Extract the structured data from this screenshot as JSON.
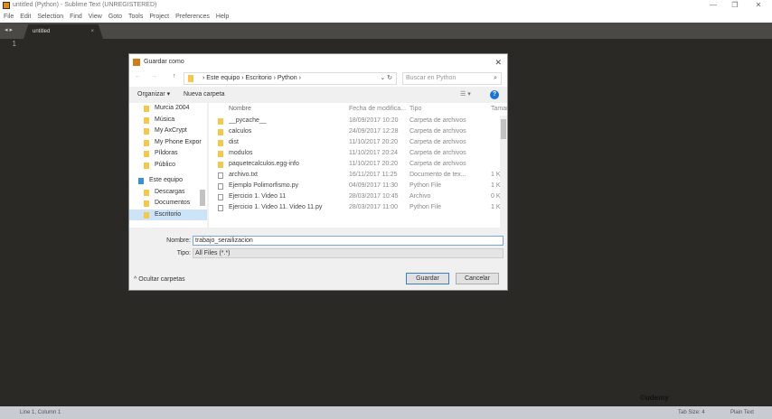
{
  "window": {
    "title": "untitled (Python) - Sublime Text (UNREGISTERED)",
    "min": "—",
    "max": "❐",
    "close": "✕"
  },
  "menu": [
    "File",
    "Edit",
    "Selection",
    "Find",
    "View",
    "Goto",
    "Tools",
    "Project",
    "Preferences",
    "Help"
  ],
  "tab": {
    "label": "untitled",
    "close": "×",
    "nav": "◂ ▸"
  },
  "editor": {
    "line": "1"
  },
  "status": {
    "left": "Line 1, Column 1",
    "tab_size": "Tab Size: 4",
    "syntax": "Plain Text"
  },
  "watermark": "©udemy",
  "dialog": {
    "title": "Guardar como",
    "close": "✕",
    "breadcrumb": "›  Este equipo  ›  Escritorio  ›  Python  ›",
    "search_placeholder": "Buscar en Python",
    "organize": "Organizar ▾",
    "new_folder": "Nueva carpeta",
    "help": "?",
    "view": "☰ ▾",
    "nav": [
      {
        "label": "Murcia 2004"
      },
      {
        "label": "Música"
      },
      {
        "label": "My AxCrypt"
      },
      {
        "label": "My Phone Expor"
      },
      {
        "label": "Píldoras"
      },
      {
        "label": "Público"
      },
      {
        "label": "Este equipo"
      },
      {
        "label": "Descargas"
      },
      {
        "label": "Documentos"
      },
      {
        "label": "Escritorio",
        "selected": true
      }
    ],
    "columns": [
      "Nombre",
      "Fecha de modifica...",
      "Tipo",
      "Tamaño"
    ],
    "files": [
      {
        "name": "__pycache__",
        "date": "18/09/2017 10:20",
        "type": "Carpeta de archivos",
        "size": "",
        "icon": "folder"
      },
      {
        "name": "calculos",
        "date": "24/09/2017 12:28",
        "type": "Carpeta de archivos",
        "size": "",
        "icon": "folder"
      },
      {
        "name": "dist",
        "date": "11/10/2017 20:20",
        "type": "Carpeta de archivos",
        "size": "",
        "icon": "folder"
      },
      {
        "name": "modulos",
        "date": "11/10/2017 20:24",
        "type": "Carpeta de archivos",
        "size": "",
        "icon": "folder"
      },
      {
        "name": "paquetecalculos.egg-info",
        "date": "11/10/2017 20:20",
        "type": "Carpeta de archivos",
        "size": "",
        "icon": "folder"
      },
      {
        "name": "archivo.txt",
        "date": "16/11/2017 11:25",
        "type": "Documento de tex...",
        "size": "1 K",
        "icon": "file"
      },
      {
        "name": "Ejemplo Polimorfismo.py",
        "date": "04/09/2017 11:30",
        "type": "Python File",
        "size": "1 K",
        "icon": "file"
      },
      {
        "name": "Ejercicio 1. Video 11",
        "date": "28/03/2017 10:45",
        "type": "Archivo",
        "size": "0 K",
        "icon": "file"
      },
      {
        "name": "Ejercicio 1. Video 11. Video 11.py",
        "date": "28/03/2017 11:00",
        "type": "Python File",
        "size": "1 K",
        "icon": "file"
      }
    ],
    "name_label": "Nombre:",
    "name_value": "trabajo_serailizacion",
    "type_label": "Tipo:",
    "type_value": "All Files (*.*)",
    "hide_folders": "^  Ocultar carpetas",
    "save": "Guardar",
    "cancel": "Cancelar"
  }
}
